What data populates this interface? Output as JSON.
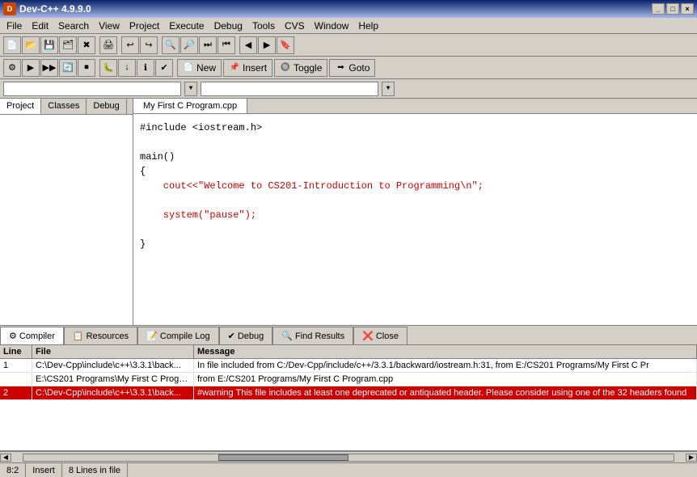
{
  "titlebar": {
    "title": "Dev-C++ 4.9.9.0",
    "min_label": "_",
    "max_label": "□",
    "close_label": "×"
  },
  "menubar": {
    "items": [
      "File",
      "Edit",
      "Search",
      "View",
      "Project",
      "Execute",
      "Debug",
      "Tools",
      "CVS",
      "Window",
      "Help"
    ]
  },
  "toolbar2": {
    "new_label": "New",
    "insert_label": "Insert",
    "toggle_label": "Toggle",
    "goto_label": "Goto"
  },
  "left_tabs": {
    "items": [
      "Project",
      "Classes",
      "Debug"
    ]
  },
  "editor_tab": {
    "filename": "My First C Program.cpp"
  },
  "code": {
    "line1": "#include <iostream.h>",
    "line2": "",
    "line3": "main()",
    "line4": "{",
    "line5": "    cout<<\"Welcome to CS201-Introduction to Programming\\n\";",
    "line6": "",
    "line7": "    system(\"pause\");",
    "line8": "",
    "line9": "}"
  },
  "bottom_tabs": {
    "items": [
      "Compiler",
      "Resources",
      "Compile Log",
      "Debug",
      "Find Results",
      "Close"
    ]
  },
  "log_table": {
    "headers": [
      "Line",
      "File",
      "Message"
    ],
    "rows": [
      {
        "line": "1",
        "file": "C:\\Dev-Cpp\\include\\c++\\3.3.1\\back...",
        "message": "In file included from C:/Dev-Cpp/include/c++/3.3.1/backward/iostream.h:31,    from E:/CS201 Programs/My First C Pr"
      },
      {
        "line": "",
        "file": "E:\\CS201 Programs\\My First C Progra...",
        "message": "from E:/CS201 Programs/My First C Program.cpp"
      },
      {
        "line": "2",
        "file": "C:\\Dev-Cpp\\include\\c++\\3.3.1\\back...",
        "message": "#warning This file includes at least one deprecated or antiquated header. Please consider using one of the 32 headers found"
      }
    ]
  },
  "status_bar": {
    "position": "8:2",
    "mode": "Insert",
    "lines": "8 Lines in file"
  }
}
